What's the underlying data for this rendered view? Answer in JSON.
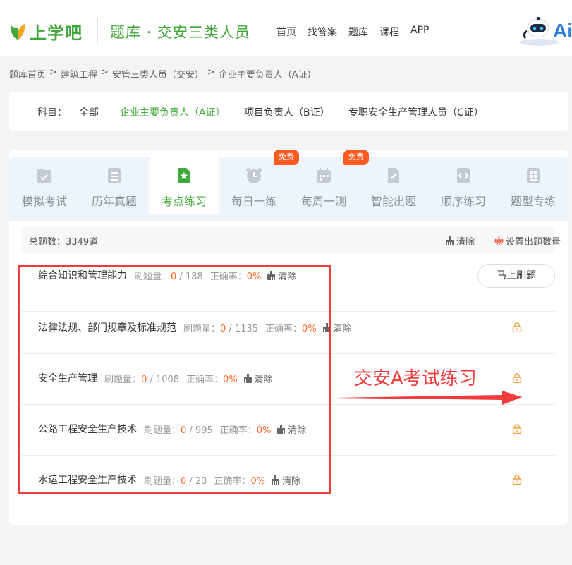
{
  "header": {
    "logo_text": "上学吧",
    "title": "题库 · 交安三类人员",
    "nav": [
      "首页",
      "找答案",
      "题库",
      "课程",
      "APP"
    ],
    "ai_text": "Ai"
  },
  "breadcrumb": [
    "题库首页",
    "建筑工程",
    "安管三类人员（交安）",
    "企业主要负责人（A证）"
  ],
  "subject": {
    "label": "科目：",
    "options": [
      "全部",
      "企业主要负责人（A证）",
      "项目负责人（B证）",
      "专职安全生产管理人员（C证）"
    ],
    "active_index": 1
  },
  "tabs": [
    {
      "label": "模拟考试",
      "icon": "checklist-icon"
    },
    {
      "label": "历年真题",
      "icon": "document-icon"
    },
    {
      "label": "考点练习",
      "icon": "star-doc-icon"
    },
    {
      "label": "每日一练",
      "icon": "alarm-clock-icon",
      "badge": "免费"
    },
    {
      "label": "每周一测",
      "icon": "calendar-icon"
    },
    {
      "label": "智能出题",
      "icon": "edit-doc-icon",
      "badge": "免费"
    },
    {
      "label": "顺序练习",
      "icon": "code-doc-icon"
    },
    {
      "label": "题型专练",
      "icon": "grid-doc-icon"
    }
  ],
  "active_tab": 2,
  "summary": {
    "total": "总题数：3349道",
    "clear": "清除",
    "setting": "设置出题数量"
  },
  "rows": [
    {
      "name": "综合知识和管理能力",
      "done_label": "刷题量：",
      "done": "0",
      "total": " / 188",
      "rate_label": "正确率：",
      "rate": "0%",
      "clear": "清除"
    },
    {
      "name": "法律法规、部门规章及标准规范",
      "done_label": "刷题量：",
      "done": "0",
      "total": " / 1135",
      "rate_label": "正确率：",
      "rate": "0%",
      "clear": "清除"
    },
    {
      "name": "安全生产管理",
      "done_label": "刷题量：",
      "done": "0",
      "total": " / 1008",
      "rate_label": "正确率：",
      "rate": "0%",
      "clear": "清除"
    },
    {
      "name": "公路工程安全生产技术",
      "done_label": "刷题量：",
      "done": "0",
      "total": " / 995",
      "rate_label": "正确率：",
      "rate": "0%",
      "clear": "清除"
    },
    {
      "name": "水运工程安全生产技术",
      "done_label": "刷题量：",
      "done": "0",
      "total": " / 23",
      "rate_label": "正确率：",
      "rate": "0%",
      "clear": "清除"
    }
  ],
  "go_button": "马上刷题",
  "annotation": "交安A考试练习",
  "colors": {
    "brand": "#43a83b",
    "accent": "#ff6a2a",
    "annotation": "#f03c3c",
    "badge": "#ff5a1f"
  }
}
